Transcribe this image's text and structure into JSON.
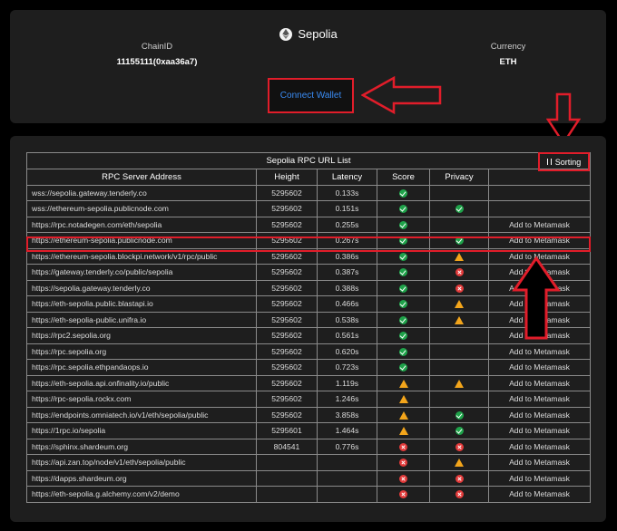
{
  "network": {
    "name": "Sepolia",
    "icon": "ethereum-icon"
  },
  "chain": {
    "label": "ChainID",
    "value": "11155111(0xaa36a7)"
  },
  "currency": {
    "label": "Currency",
    "value": "ETH"
  },
  "connect_button": {
    "label": "Connect Wallet"
  },
  "table": {
    "title": "Sepolia RPC URL List",
    "sorting_label": "Sorting",
    "columns": [
      "RPC Server Address",
      "Height",
      "Latency",
      "Score",
      "Privacy",
      ""
    ],
    "rows": [
      {
        "url": "wss://sepolia.gateway.tenderly.co",
        "height": "5295602",
        "latency": "0.133s",
        "score": "ok",
        "privacy": "",
        "action": ""
      },
      {
        "url": "wss://ethereum-sepolia.publicnode.com",
        "height": "5295602",
        "latency": "0.151s",
        "score": "ok",
        "privacy": "ok",
        "action": ""
      },
      {
        "url": "https://rpc.notadegen.com/eth/sepolia",
        "height": "5295602",
        "latency": "0.255s",
        "score": "ok",
        "privacy": "",
        "action": "Add to Metamask"
      },
      {
        "url": "https://ethereum-sepolia.publicnode.com",
        "height": "5295602",
        "latency": "0.267s",
        "score": "ok",
        "privacy": "ok",
        "action": "Add to Metamask"
      },
      {
        "url": "https://ethereum-sepolia.blockpi.network/v1/rpc/public",
        "height": "5295602",
        "latency": "0.386s",
        "score": "ok",
        "privacy": "warn",
        "action": "Add to Metamask"
      },
      {
        "url": "https://gateway.tenderly.co/public/sepolia",
        "height": "5295602",
        "latency": "0.387s",
        "score": "ok",
        "privacy": "bad",
        "action": "Add to Metamask"
      },
      {
        "url": "https://sepolia.gateway.tenderly.co",
        "height": "5295602",
        "latency": "0.388s",
        "score": "ok",
        "privacy": "bad",
        "action": "Add to Metamask"
      },
      {
        "url": "https://eth-sepolia.public.blastapi.io",
        "height": "5295602",
        "latency": "0.466s",
        "score": "ok",
        "privacy": "warn",
        "action": "Add to Metamask"
      },
      {
        "url": "https://eth-sepolia-public.unifra.io",
        "height": "5295602",
        "latency": "0.538s",
        "score": "ok",
        "privacy": "warn",
        "action": "Add to Metamask"
      },
      {
        "url": "https://rpc2.sepolia.org",
        "height": "5295602",
        "latency": "0.561s",
        "score": "ok",
        "privacy": "",
        "action": "Add to Metamask"
      },
      {
        "url": "https://rpc.sepolia.org",
        "height": "5295602",
        "latency": "0.620s",
        "score": "ok",
        "privacy": "",
        "action": "Add to Metamask"
      },
      {
        "url": "https://rpc.sepolia.ethpandaops.io",
        "height": "5295602",
        "latency": "0.723s",
        "score": "ok",
        "privacy": "",
        "action": "Add to Metamask"
      },
      {
        "url": "https://eth-sepolia.api.onfinality.io/public",
        "height": "5295602",
        "latency": "1.119s",
        "score": "warn",
        "privacy": "warn",
        "action": "Add to Metamask"
      },
      {
        "url": "https://rpc-sepolia.rockx.com",
        "height": "5295602",
        "latency": "1.246s",
        "score": "warn",
        "privacy": "",
        "action": "Add to Metamask"
      },
      {
        "url": "https://endpoints.omniatech.io/v1/eth/sepolia/public",
        "height": "5295602",
        "latency": "3.858s",
        "score": "warn",
        "privacy": "ok",
        "action": "Add to Metamask"
      },
      {
        "url": "https://1rpc.io/sepolia",
        "height": "5295601",
        "latency": "1.464s",
        "score": "warn",
        "privacy": "ok",
        "action": "Add to Metamask"
      },
      {
        "url": "https://sphinx.shardeum.org",
        "height": "804541",
        "latency": "0.776s",
        "score": "bad",
        "privacy": "bad",
        "action": "Add to Metamask"
      },
      {
        "url": "https://api.zan.top/node/v1/eth/sepolia/public",
        "height": "",
        "latency": "",
        "score": "bad",
        "privacy": "warn",
        "action": "Add to Metamask"
      },
      {
        "url": "https://dapps.shardeum.org",
        "height": "",
        "latency": "",
        "score": "bad",
        "privacy": "bad",
        "action": "Add to Metamask"
      },
      {
        "url": "https://eth-sepolia.g.alchemy.com/v2/demo",
        "height": "",
        "latency": "",
        "score": "bad",
        "privacy": "bad",
        "action": "Add to Metamask"
      }
    ]
  },
  "colors": {
    "background": "#000000",
    "card": "#1e1e1e",
    "accent_link": "#3a8cf5",
    "highlight_red": "#e11d2a",
    "ok_green": "#1fa34a",
    "warn_orange": "#f3a51b",
    "bad_red": "#e23a3a"
  }
}
